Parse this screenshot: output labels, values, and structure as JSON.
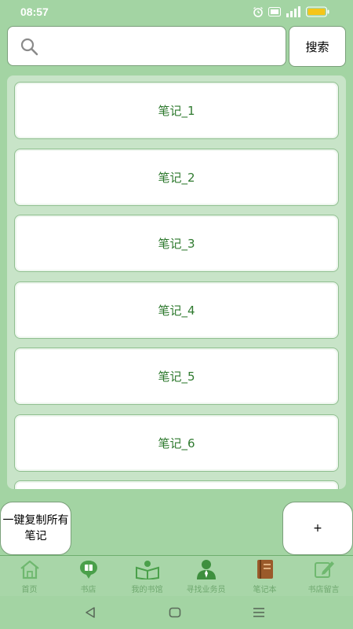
{
  "status_bar": {
    "time": "08:57"
  },
  "search": {
    "placeholder": "",
    "value": "",
    "button_label": "搜索"
  },
  "notes": [
    {
      "label": "笔记_1"
    },
    {
      "label": "笔记_2"
    },
    {
      "label": "笔记_3"
    },
    {
      "label": "笔记_4"
    },
    {
      "label": "笔记_5"
    },
    {
      "label": "笔记_6"
    },
    {
      "label": ""
    }
  ],
  "actions": {
    "copy_all_label": "一键复制所有笔记",
    "add_label": "+"
  },
  "bottom_nav": [
    {
      "label": "首页",
      "icon": "home-icon"
    },
    {
      "label": "书店",
      "icon": "bookstore-icon"
    },
    {
      "label": "我的书馆",
      "icon": "library-icon"
    },
    {
      "label": "寻找业务员",
      "icon": "salesperson-icon"
    },
    {
      "label": "笔记本",
      "icon": "notebook-icon"
    },
    {
      "label": "书店留言",
      "icon": "message-icon"
    }
  ],
  "colors": {
    "background": "#a3d4a3",
    "note_text": "#2f7a2f",
    "nav_label": "#6fa86f",
    "battery": "#f5c518"
  }
}
